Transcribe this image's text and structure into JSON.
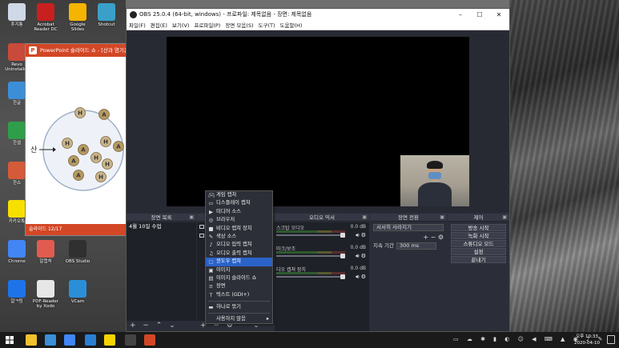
{
  "desktop": {
    "icons": [
      {
        "label": "휴지통",
        "color": "#cfd8e6"
      },
      {
        "label": "Acrobat Reader DC",
        "color": "#c8201e"
      },
      {
        "label": "Google Slides",
        "color": "#f4b400"
      },
      {
        "label": "Shotcut",
        "color": "#3aa0c8"
      },
      {
        "label": "Revo Uninstaller",
        "color": "#c94a3a"
      },
      {
        "label": "한글",
        "color": "#3c8fd6"
      },
      {
        "label": "한셀",
        "color": "#2f9e4a"
      },
      {
        "label": "한쇼",
        "color": "#d45a3a"
      },
      {
        "label": "카카오톡",
        "color": "#f7e000"
      },
      {
        "label": "Chrome",
        "color": "#4285f4"
      },
      {
        "label": "알캡처",
        "color": "#e25b4f"
      },
      {
        "label": "OBS Studio",
        "color": "#303030"
      },
      {
        "label": "알ㅋ팅",
        "color": "#1e73e8"
      },
      {
        "label": "PDF-Reader by Xodo",
        "color": "#e6e6e6"
      },
      {
        "label": "VCam",
        "color": "#2a8fd8"
      }
    ]
  },
  "powerpoint": {
    "title": "PowerPoint 슬라이드 쇼 - [산과 염기는",
    "status": "슬라이드 12/17",
    "slide_label": "산",
    "ions": [
      "H",
      "A",
      "H",
      "A",
      "H",
      "A",
      "H",
      "A",
      "H",
      "A",
      "H"
    ]
  },
  "obs": {
    "title": "OBS 25.0.4 (64-bit, windows) - 프로파일: 제목없음 - 장면: 제목없음",
    "window_controls": {
      "min": "–",
      "max": "☐",
      "close": "✕"
    },
    "menu": [
      "파일(F)",
      "편집(E)",
      "보기(V)",
      "프로파일(P)",
      "장면 모음(S)",
      "도구(T)",
      "도움말(H)"
    ],
    "scenes": {
      "header": "장면 목록",
      "items": [
        "4월 10일 수업"
      ]
    },
    "mixer": {
      "header": "오디오 믹서",
      "channels": [
        {
          "name": "스크탑 오디오",
          "db": "0.0 dB"
        },
        {
          "name": "마크/보조",
          "db": "0.0 dB"
        },
        {
          "name": "디오 캡쳐 장치",
          "db": "0.0 dB"
        }
      ]
    },
    "transitions": {
      "header": "장면 전환",
      "type": "서서히 사라지기",
      "duration_label": "지속 기간",
      "duration": "300 ms"
    },
    "controls": {
      "header": "제어",
      "buttons": [
        "방송 시작",
        "녹화 시작",
        "스튜디오 모드",
        "설정",
        "끝내기"
      ]
    },
    "footer_buttons": "+ − ⌃ ⌄"
  },
  "context_menu": {
    "items": [
      {
        "label": "게임 캡쳐",
        "icon": "gamepad-icon"
      },
      {
        "label": "디스플레이 캡쳐",
        "icon": "monitor-icon"
      },
      {
        "label": "미디어 소스",
        "icon": "play-icon"
      },
      {
        "label": "브라우저",
        "icon": "globe-icon"
      },
      {
        "label": "비디오 캡쳐 장치",
        "icon": "camera-icon"
      },
      {
        "label": "색상 소스",
        "icon": "brush-icon"
      },
      {
        "label": "오디오 입력 캡쳐",
        "icon": "microphone-icon"
      },
      {
        "label": "오디오 출력 캡쳐",
        "icon": "speaker-icon"
      },
      {
        "label": "윈도우 캡쳐",
        "icon": "window-icon",
        "selected": true
      },
      {
        "label": "이미지",
        "icon": "image-icon"
      },
      {
        "label": "이미지 슬라이드 쇼",
        "icon": "slideshow-icon"
      },
      {
        "label": "장면",
        "icon": "list-icon"
      },
      {
        "label": "텍스트 (GDI+)",
        "icon": "text-icon"
      },
      {
        "label": "하나로 묶기",
        "icon": "folder-icon",
        "group": "after"
      },
      {
        "label": "사용하지 않음",
        "icon": "",
        "submenu": true,
        "group": "after2"
      }
    ]
  },
  "taskbar": {
    "time": "오후 10:33",
    "date": "2020-04-10",
    "apps": [
      {
        "name": "file-explorer-icon",
        "color": "#f2c12e"
      },
      {
        "name": "store-icon",
        "color": "#3a8fd8"
      },
      {
        "name": "chrome-icon",
        "color": "#4285f4"
      },
      {
        "name": "edge-icon",
        "color": "#2a7fd4"
      },
      {
        "name": "sticky-notes-icon",
        "color": "#f7d400"
      },
      {
        "name": "obs-icon",
        "color": "#444"
      },
      {
        "name": "powerpoint-icon",
        "color": "#d24726"
      }
    ]
  }
}
